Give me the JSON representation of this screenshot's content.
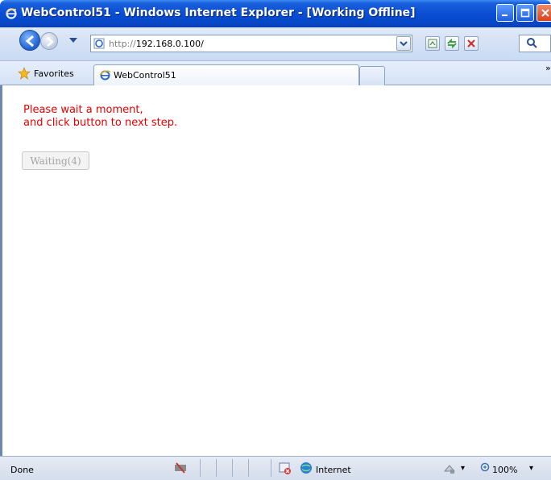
{
  "window": {
    "title": "WebControl51 - Windows Internet Explorer - [Working Offline]"
  },
  "address_bar": {
    "url_protocol": "http://",
    "url_host": "192.168.0.100/"
  },
  "favorites": {
    "label": "Favorites"
  },
  "tabs": [
    {
      "label": "WebControl51",
      "active": true
    }
  ],
  "page": {
    "message_line1": "Please wait a moment,",
    "message_line2": "and click button to next step.",
    "wait_button_label": "Waiting(4)",
    "message_color": "#e60000"
  },
  "status_bar": {
    "status": "Done",
    "zone": "Internet",
    "zoom": "100%"
  }
}
